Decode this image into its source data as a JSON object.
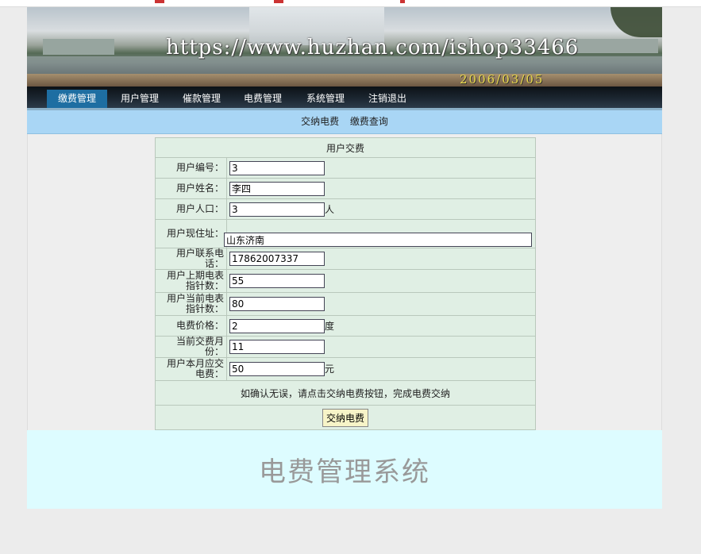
{
  "banner": {
    "watermark": "https://www.huzhan.com/ishop33466",
    "date": "2006/03/05"
  },
  "nav": {
    "items": [
      {
        "label": "缴费管理",
        "active": true
      },
      {
        "label": "用户管理"
      },
      {
        "label": "催款管理"
      },
      {
        "label": "电费管理"
      },
      {
        "label": "系统管理"
      },
      {
        "label": "注销退出"
      }
    ]
  },
  "subnav": {
    "links": [
      "交纳电费",
      "缴费查询"
    ]
  },
  "form": {
    "title": "用户交费",
    "fields": {
      "user_id": {
        "label": "用户编号：",
        "value": "3"
      },
      "user_name": {
        "label": "用户姓名：",
        "value": "李四"
      },
      "population": {
        "label": "用户人口：",
        "value": "3",
        "unit": "人"
      },
      "address": {
        "label": "用户现住址：",
        "value": "山东济南"
      },
      "phone": {
        "label": "用户联系电话：",
        "value": "17862007337"
      },
      "last_meter": {
        "label": "用户上期电表指针数：",
        "value": "55"
      },
      "current_meter": {
        "label": "用户当前电表指针数：",
        "value": "80"
      },
      "price": {
        "label": "电费价格：",
        "value": "2",
        "unit": "度"
      },
      "month": {
        "label": "当前交费月份：",
        "value": "11"
      },
      "amount": {
        "label": "用户本月应交电费：",
        "value": "50",
        "unit": "元"
      }
    },
    "notice": "如确认无误，请点击交纳电费按钮，完成电费交纳",
    "submit_label": "交纳电费"
  },
  "footer": {
    "title": "电费管理系统"
  },
  "colors": {
    "nav_active": "#1e6ea2",
    "subbar": "#a9d6f5",
    "form_bg": "#e0efe4",
    "footer_bg": "#ddfcff"
  }
}
